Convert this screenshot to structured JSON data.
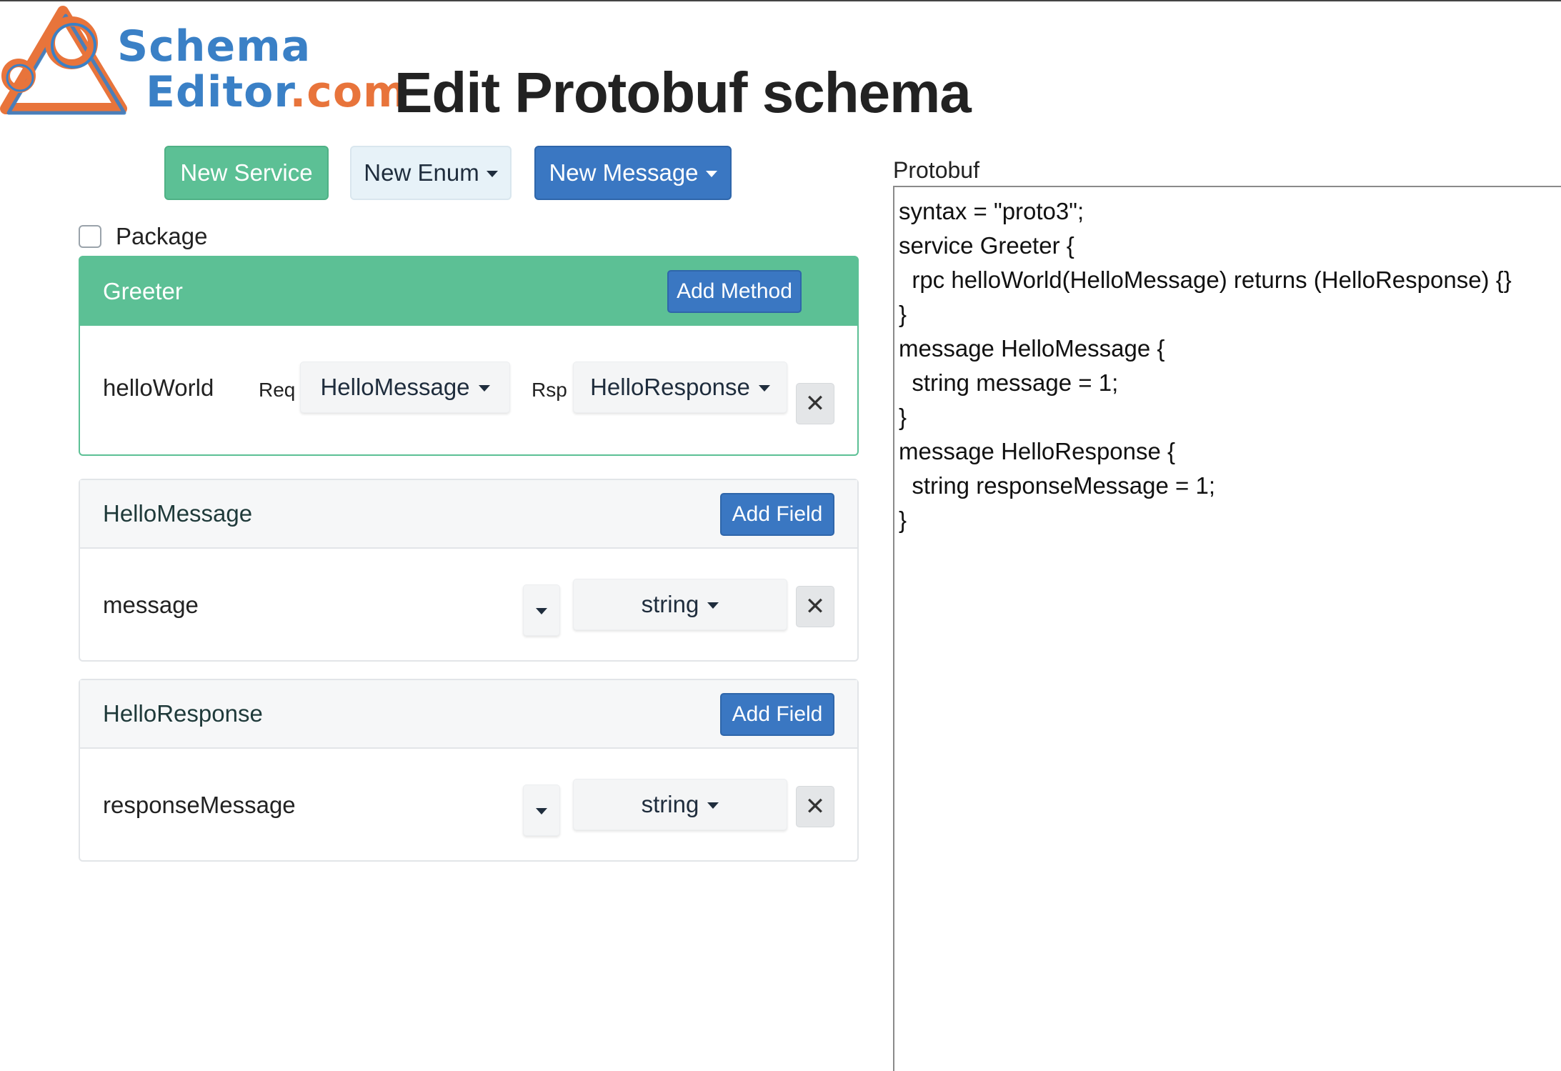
{
  "header": {
    "logo_line1": "Schema",
    "logo_line2_main": "Editor",
    "logo_line2_suffix": ".com",
    "page_title": "Edit Protobuf schema"
  },
  "toolbar": {
    "new_service": "New Service",
    "new_enum": "New Enum",
    "new_message": "New Message"
  },
  "package": {
    "label": "Package",
    "checked": false
  },
  "service": {
    "name": "Greeter",
    "add_method_label": "Add Method",
    "methods": [
      {
        "name": "helloWorld",
        "req_label": "Req",
        "req_type": "HelloMessage",
        "rsp_label": "Rsp",
        "rsp_type": "HelloResponse"
      }
    ]
  },
  "messages": [
    {
      "name": "HelloMessage",
      "add_field_label": "Add Field",
      "fields": [
        {
          "name": "message",
          "type": "string"
        }
      ]
    },
    {
      "name": "HelloResponse",
      "add_field_label": "Add Field",
      "fields": [
        {
          "name": "responseMessage",
          "type": "string"
        }
      ]
    }
  ],
  "remove_glyph": "✕",
  "protobuf": {
    "label": "Protobuf",
    "lines": [
      "syntax = \"proto3\";",
      "",
      "service Greeter {",
      "  rpc helloWorld(HelloMessage) returns (HelloResponse) {}",
      "}",
      "",
      "message HelloMessage {",
      "  string message = 1;",
      "}",
      "",
      "message HelloResponse {",
      "  string responseMessage = 1;",
      "}"
    ]
  },
  "colors": {
    "accent_green": "#5cc095",
    "accent_blue": "#3a77c2",
    "logo_blue": "#3a80c6",
    "logo_orange": "#e8743b"
  }
}
